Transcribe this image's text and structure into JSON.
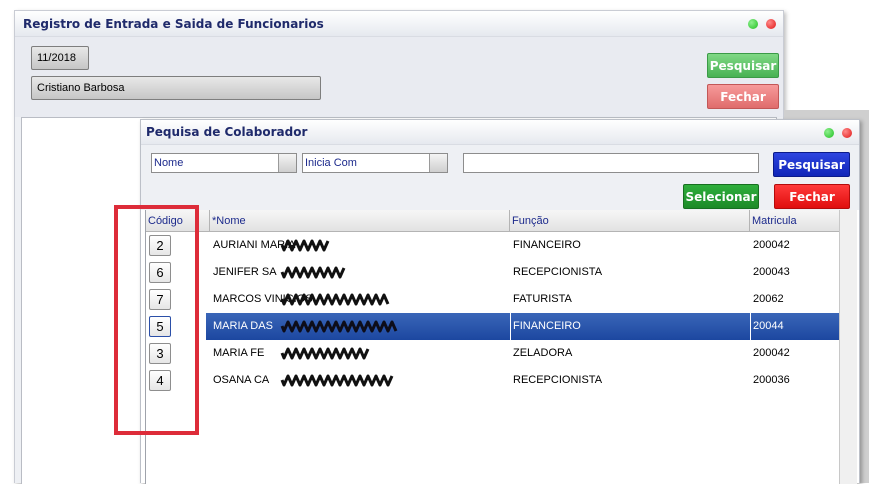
{
  "main_window": {
    "title": "Registro de Entrada e Saida de Funcionarios",
    "period_value": "11/2018",
    "employee_value": "Cristiano Barbosa",
    "search_label": "Pesquisar",
    "close_label": "Fechar"
  },
  "dialog": {
    "title": "Pequisa de Colaborador",
    "field_combo_value": "Nome",
    "operator_combo_value": "Inicia Com",
    "search_text_value": "",
    "search_label": "Pesquisar",
    "select_label": "Selecionar",
    "close_label": "Fechar",
    "columns": [
      "Código",
      "*Nome",
      "Função",
      "Matricula"
    ],
    "rows": [
      {
        "code": "2",
        "name": "AURIANI MARIA",
        "role": "FINANCEIRO",
        "registration": "200042"
      },
      {
        "code": "6",
        "name": "JENIFER SA",
        "role": "RECEPCIONISTA",
        "registration": "200043"
      },
      {
        "code": "7",
        "name": "MARCOS VINICIOS",
        "role": "FATURISTA",
        "registration": "20062"
      },
      {
        "code": "5",
        "name": "MARIA DAS",
        "role": "FINANCEIRO",
        "registration": "20044"
      },
      {
        "code": "3",
        "name": "MARIA FE",
        "role": "ZELADORA",
        "registration": "200042"
      },
      {
        "code": "4",
        "name": "OSANA CA",
        "role": "RECEPCIONISTA",
        "registration": "200036"
      }
    ],
    "selected_row_index": 3
  },
  "colors": {
    "title_text": "#1f2a6b",
    "button_green": "#2e9a3a",
    "button_red": "#ee2020",
    "button_blue": "#1530c8",
    "selection": "#1c47a0",
    "annotation_red": "#dd2c39"
  }
}
